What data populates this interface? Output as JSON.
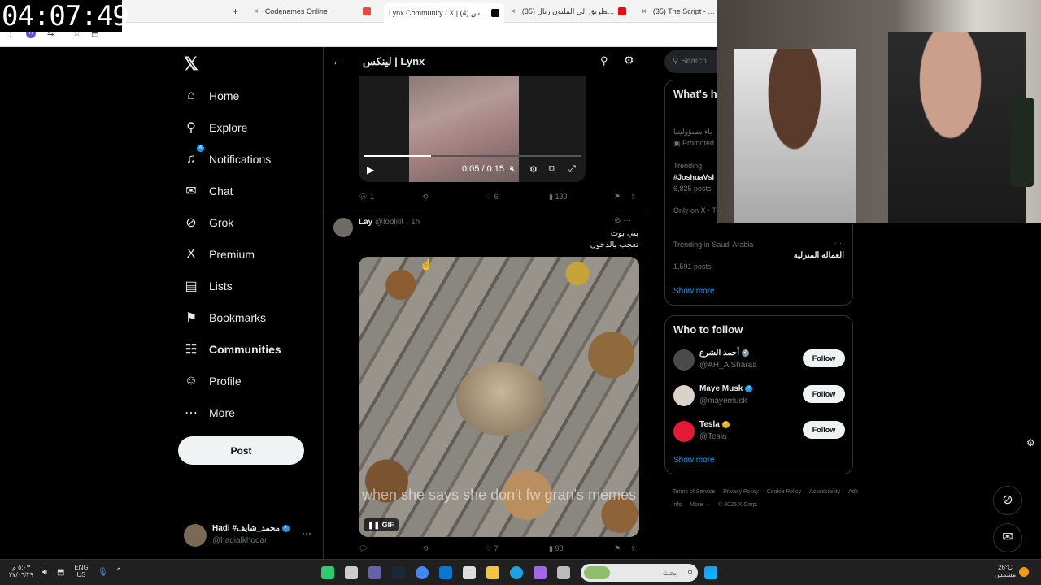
{
  "timer": "04:07:49",
  "browser": {
    "tabs": [
      {
        "label": "Codenames Online",
        "active": false,
        "fav_color": "#e64b3c"
      },
      {
        "label": "Lynx Community / X | لينكس (4)",
        "active": true,
        "fav_color": "#000000"
      },
      {
        "label": "(35) الطريق الى المليون ريال #",
        "active": false,
        "fav_color": "#ff0000"
      },
      {
        "label": "(35) The Script - Hall O",
        "active": false,
        "fav_color": "#ff0000"
      }
    ],
    "new_tab": "+",
    "close_glyph": "×"
  },
  "nav": {
    "items": [
      {
        "label": "Home",
        "icon": "⌂",
        "name": "home"
      },
      {
        "label": "Explore",
        "icon": "⚲",
        "name": "explore"
      },
      {
        "label": "Notifications",
        "icon": "♫",
        "name": "notifications",
        "badge": "4"
      },
      {
        "label": "Chat",
        "icon": "✉",
        "name": "chat"
      },
      {
        "label": "Grok",
        "icon": "⊘",
        "name": "grok"
      },
      {
        "label": "Premium",
        "icon": "X",
        "name": "premium"
      },
      {
        "label": "Lists",
        "icon": "▤",
        "name": "lists"
      },
      {
        "label": "Bookmarks",
        "icon": "⚑",
        "name": "bookmarks"
      },
      {
        "label": "Communities",
        "icon": "☷",
        "name": "communities",
        "bold": true
      },
      {
        "label": "Profile",
        "icon": "☺",
        "name": "profile"
      },
      {
        "label": "More",
        "icon": "⋯",
        "name": "more"
      }
    ],
    "post_label": "Post",
    "user": {
      "name": "Hadi #محمد_شايف",
      "handle": "@hadialkhodari",
      "more": "···"
    }
  },
  "community": {
    "title": "لينكس | Lynx",
    "video": {
      "time": "0:05 / 0:15",
      "progress": 0.31
    },
    "video_actions": {
      "replies": "1",
      "reposts": "",
      "likes": "6",
      "views": "139"
    },
    "tweet": {
      "name": "Lay",
      "handle": "@looliiit",
      "time": "· 1h",
      "lines": [
        "بني بوت",
        "تعجب بالدخول"
      ],
      "gif_caption": "when she says she don't fw gran's memes",
      "gif_label": "GIF",
      "actions": {
        "replies": "",
        "reposts": "",
        "likes": "7",
        "views": "98"
      }
    }
  },
  "right": {
    "search_placeholder": "Search",
    "whats_happening": "What's h",
    "promo_text": "باء مسؤوليتنا",
    "promoted": "Promoted",
    "trend1_ctx": "Trending",
    "trend1_tag": "#JoshuaVsI",
    "trend1_count": "6,825 posts",
    "only_on_x": "Only on X · Trend",
    "trend2_ctx": "Trending in Saudi Arabia",
    "trend2_more": "···",
    "trend2_name": "العماله المنزليه",
    "trend2_count": "1,591 posts",
    "show_more": "Show more",
    "who_to_follow": "Who to follow",
    "follow_label": "Follow",
    "follows": [
      {
        "name": "أحمد الشرع",
        "handle": "@AH_AlSharaa",
        "verified_color": "#829aab",
        "avatar": "#4a4a4a"
      },
      {
        "name": "Maye Musk",
        "handle": "@mayemusk",
        "verified_color": "#1d9bf0",
        "avatar": "#d8d2ca"
      },
      {
        "name": "Tesla",
        "handle": "@Tesla",
        "verified_color": "#e2b719",
        "avatar": "#e31937"
      }
    ],
    "show_more2": "Show more",
    "footer": [
      "Terms of Service",
      "Privacy Policy",
      "Cookie Policy",
      "Accessibility",
      "Ads info",
      "More ···",
      "© 2025 X Corp."
    ]
  },
  "taskbar": {
    "clock_time": "٥:٠٣ م",
    "clock_date": "٢٧/٠٦/٢٩",
    "lang_top": "ENG",
    "lang_bottom": "US",
    "search_placeholder": "بحث",
    "weather_temp": "26°C",
    "weather_desc": "مشمس"
  }
}
